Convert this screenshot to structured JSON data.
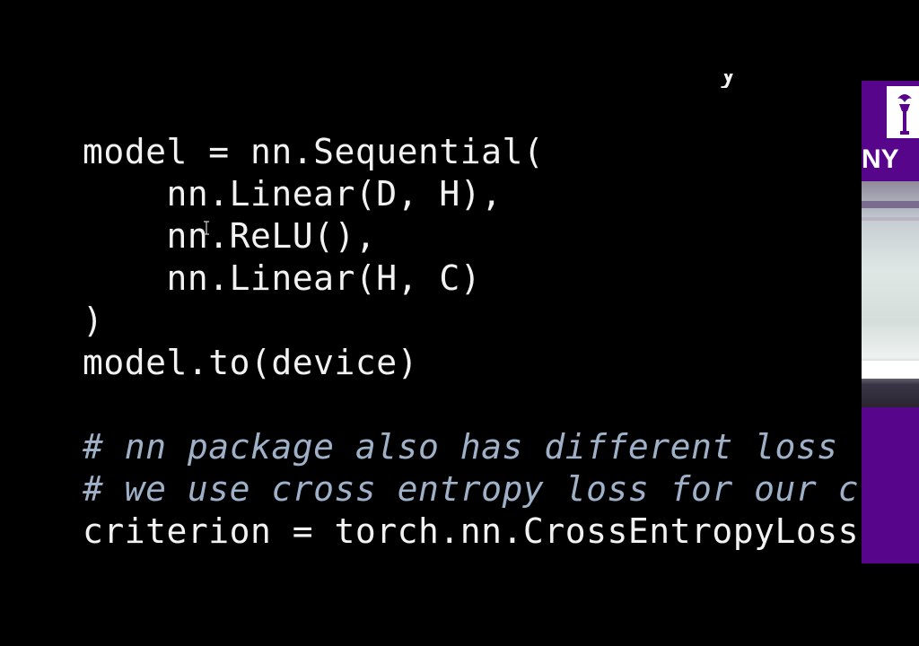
{
  "code": {
    "lines": [
      {
        "text": "model = nn.Sequential(",
        "kind": "code"
      },
      {
        "text": "    nn.Linear(D, H),",
        "kind": "code"
      },
      {
        "text": "    nn.ReLU(),",
        "kind": "code"
      },
      {
        "text": "    nn.Linear(H, C)",
        "kind": "code"
      },
      {
        "text": ")",
        "kind": "code"
      },
      {
        "text": "model.to(device)",
        "kind": "code"
      },
      {
        "text": "",
        "kind": "blank"
      },
      {
        "text": "# nn package also has different loss",
        "kind": "comment"
      },
      {
        "text": "# we use cross entropy loss for our c",
        "kind": "comment"
      },
      {
        "text": "criterion = torch.nn.CrossEntropyLoss",
        "kind": "code"
      }
    ],
    "partial_top_char": "y"
  },
  "side_panel": {
    "logo_text": "NY",
    "logo_icon": "torch-icon"
  },
  "colors": {
    "background": "#000000",
    "code_text": "#f2f2f2",
    "comment_text": "#9fb1c8",
    "brand_purple": "#57068c"
  }
}
